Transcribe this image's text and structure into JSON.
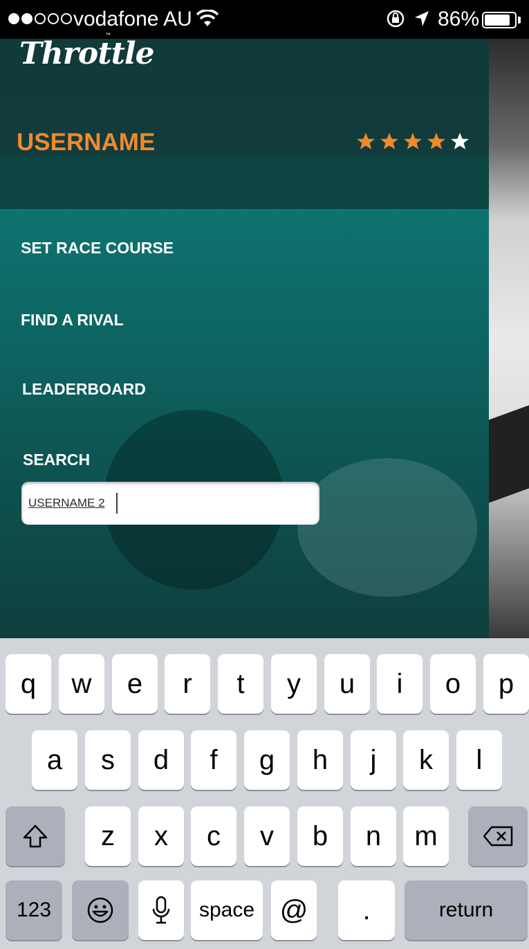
{
  "status_bar": {
    "carrier": "vodafone AU",
    "signal_bars_filled": 2,
    "signal_bars_total": 5,
    "battery_percent": "86%",
    "battery_level": 0.86,
    "icons": [
      "signal-dots",
      "wifi-icon",
      "orientation-lock-icon",
      "location-arrow-icon",
      "battery-icon"
    ]
  },
  "app": {
    "logo_text": "Throttle",
    "logo_tm": "™"
  },
  "user": {
    "username": "USERNAME",
    "rating_filled": 4,
    "rating_total": 5,
    "star_color_filled": "#f08a2c",
    "star_color_empty": "#ffffff"
  },
  "menu": {
    "items": [
      {
        "label": "SET RACE COURSE"
      },
      {
        "label": "FIND A RIVAL"
      },
      {
        "label": "LEADERBOARD"
      }
    ],
    "search_label": "SEARCH",
    "search_value": "USERNAME 2"
  },
  "colors": {
    "accent": "#f08a2c",
    "panel_teal": "#0d6562",
    "panel_dark": "#0f3a3a"
  },
  "keyboard": {
    "row1": [
      "q",
      "w",
      "e",
      "r",
      "t",
      "y",
      "u",
      "i",
      "o",
      "p"
    ],
    "row2": [
      "a",
      "s",
      "d",
      "f",
      "g",
      "h",
      "j",
      "k",
      "l"
    ],
    "row3": [
      "z",
      "x",
      "c",
      "v",
      "b",
      "n",
      "m"
    ],
    "numbers_label": "123",
    "space_label": "space",
    "at_label": "@",
    "period_label": ".",
    "return_label": "return"
  }
}
